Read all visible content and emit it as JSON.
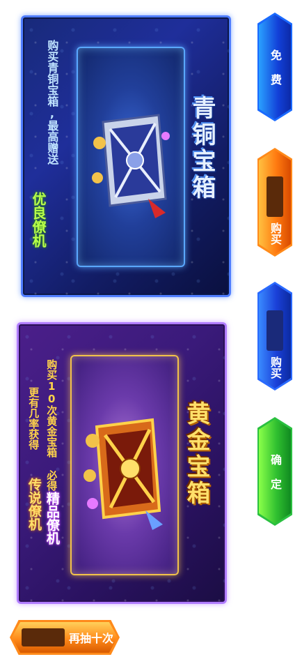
{
  "bronze_panel": {
    "title": "青铜宝箱",
    "desc": "购买青铜宝箱,最高赠送",
    "highlight": "优良僚机"
  },
  "gold_panel": {
    "title": "黄金宝箱",
    "desc_line1a": "购买10次黄金宝箱 必得",
    "desc_line1b": "精品僚机",
    "desc_line2a": "更有几率获得",
    "desc_line2b": "传说僚机"
  },
  "buttons": {
    "free": "免 费",
    "buy1": "购买",
    "buy2": "购买",
    "confirm": "确 定",
    "redraw": "再抽十次"
  },
  "colors": {
    "bronze_accent": "#4f7dff",
    "gold_accent": "#f2c24a",
    "orange_button": "#ff8a1a",
    "blue_button": "#1a6aff",
    "green_button": "#2ac040"
  }
}
